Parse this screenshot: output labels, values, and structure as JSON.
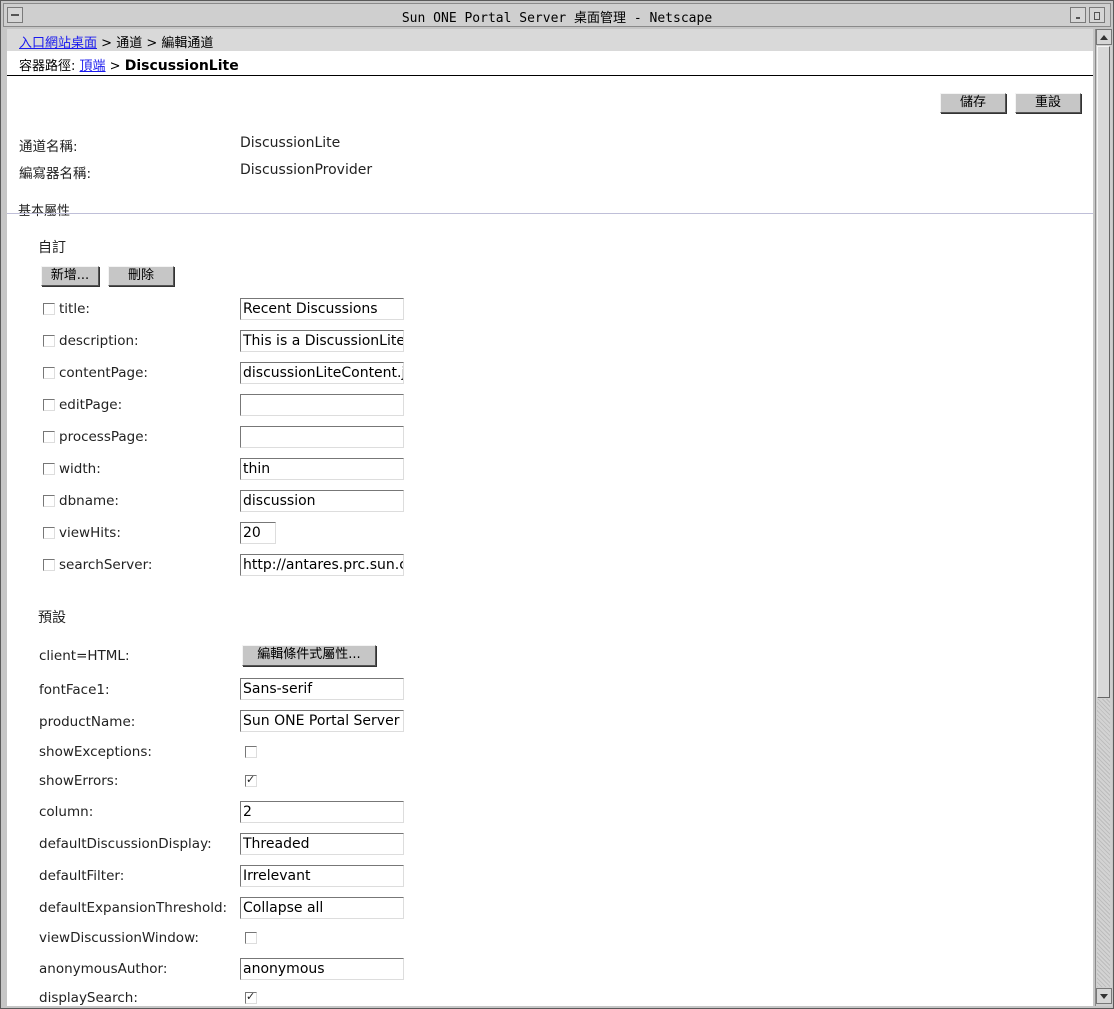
{
  "window": {
    "title": "Sun ONE Portal Server 桌面管理 - Netscape"
  },
  "breadcrumb": {
    "link_label": "入口網站桌面",
    "sep": " > ",
    "item2": "通道",
    "item3": "編輯通道"
  },
  "container_path": {
    "label": "容器路徑:",
    "top_link": "頂端",
    "sep": " > ",
    "current": "DiscussionLite"
  },
  "toolbar": {
    "save_label": "儲存",
    "reset_label": "重設"
  },
  "channel": {
    "name_label": "通道名稱:",
    "name_value": "DiscussionLite",
    "provider_label": "編寫器名稱:",
    "provider_value": "DiscussionProvider"
  },
  "basic_props": {
    "title": "基本屬性"
  },
  "custom": {
    "title": "自訂",
    "add_label": "新增...",
    "delete_label": "刪除",
    "rows": [
      {
        "label": "title:",
        "value": "Recent Discussions"
      },
      {
        "label": "description:",
        "value": "This is a DiscussionLite p"
      },
      {
        "label": "contentPage:",
        "value": "discussionLiteContent.jsp"
      },
      {
        "label": "editPage:",
        "value": ""
      },
      {
        "label": "processPage:",
        "value": ""
      },
      {
        "label": "width:",
        "value": "thin"
      },
      {
        "label": "dbname:",
        "value": "discussion"
      },
      {
        "label": "viewHits:",
        "value": "20"
      },
      {
        "label": "searchServer:",
        "value": "http://antares.prc.sun.com"
      }
    ]
  },
  "defaults": {
    "title": "預設",
    "client_label": "client=HTML:",
    "edit_cond_label": "編輯條件式屬性...",
    "fontFace1_label": "fontFace1:",
    "fontFace1_value": "Sans-serif",
    "productName_label": "productName:",
    "productName_value": "Sun ONE Portal Server",
    "showExceptions_label": "showExceptions:",
    "showErrors_label": "showErrors:",
    "column_label": "column:",
    "column_value": "2",
    "defaultDiscussionDisplay_label": "defaultDiscussionDisplay:",
    "defaultDiscussionDisplay_value": "Threaded",
    "defaultFilter_label": "defaultFilter:",
    "defaultFilter_value": "Irrelevant",
    "defaultExpansionThreshold_label": "defaultExpansionThreshold:",
    "defaultExpansionThreshold_value": "Collapse all",
    "viewDiscussionWindow_label": "viewDiscussionWindow:",
    "anonymousAuthor_label": "anonymousAuthor:",
    "anonymousAuthor_value": "anonymous",
    "displaySearch_label": "displaySearch:"
  }
}
